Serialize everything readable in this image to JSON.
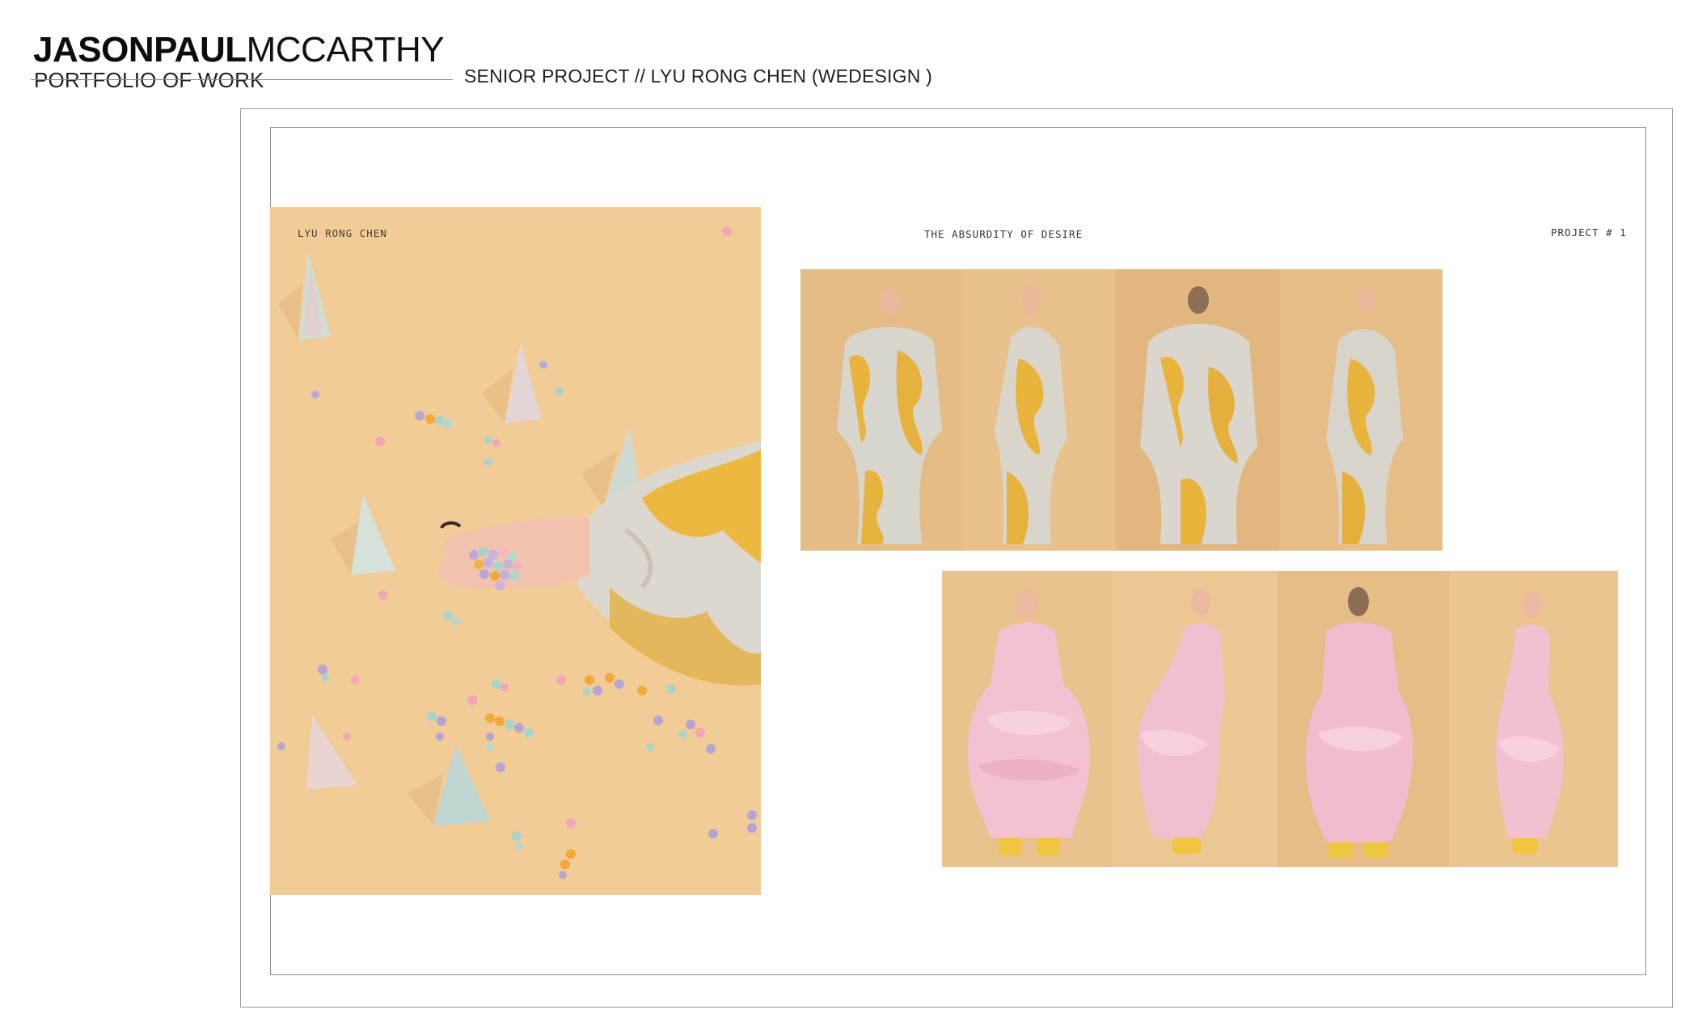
{
  "header": {
    "name_bold": "JASONPAUL",
    "name_light": "MCCARTHY",
    "subtitle": "PORTFOLIO OF WORK",
    "project_heading": "SENIOR PROJECT // LYU RONG CHEN (WEDESIGN )"
  },
  "spread": {
    "designer_label": "LYU RONG  CHEN",
    "collection_title": "THE ABSURDITY OF   DESIRE",
    "project_number": "PROJECT # 1"
  },
  "colors": {
    "backdrop": "#f2cc96",
    "gold_fabric": "#e9b53c",
    "silver_fabric": "#d9d6cf",
    "pink_fabric": "#f3bfd0",
    "frame_line": "#9a9a9a"
  }
}
